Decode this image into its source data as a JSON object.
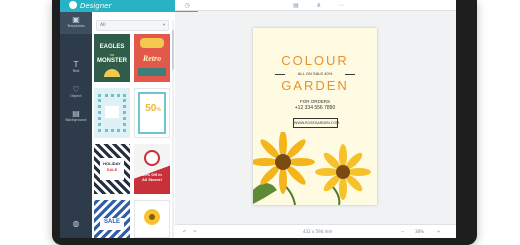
{
  "app": {
    "logo_text": "Designer"
  },
  "rail": [
    {
      "label": "Templates",
      "icon": "template-icon"
    },
    {
      "label": "Text",
      "icon": "text-icon"
    },
    {
      "label": "Object",
      "icon": "object-icon"
    },
    {
      "label": "Background",
      "icon": "background-icon"
    }
  ],
  "panel": {
    "filter": "All"
  },
  "thumbs": {
    "eagles": {
      "line1": "EAGLES",
      "line2": "vs",
      "line3": "MONSTER"
    },
    "retro": {
      "line1": "Retro"
    },
    "fifty": {
      "line1": "50",
      "line2": "%"
    },
    "holiday": {
      "line1": "HOLIDAY",
      "line2": "SALE"
    },
    "allstore": {
      "line1": "50% Off in",
      "line2": "All Stores!"
    },
    "sale": {
      "line1": "SALE"
    }
  },
  "poster": {
    "title1": "COLOUR",
    "tagline": "ALL ON SALE 40%",
    "title2": "GARDEN",
    "orders_label": "FOR ORDERS",
    "phone": "+12 334 556 7890",
    "website": "WWW.ROSEGARDEN.COM"
  },
  "bottombar": {
    "size": "432 x 594 mm",
    "zoom": "38%"
  },
  "colors": {
    "accent": "#27b3c4",
    "rail": "#2d3b4a",
    "poster_orange": "#e8912d"
  }
}
